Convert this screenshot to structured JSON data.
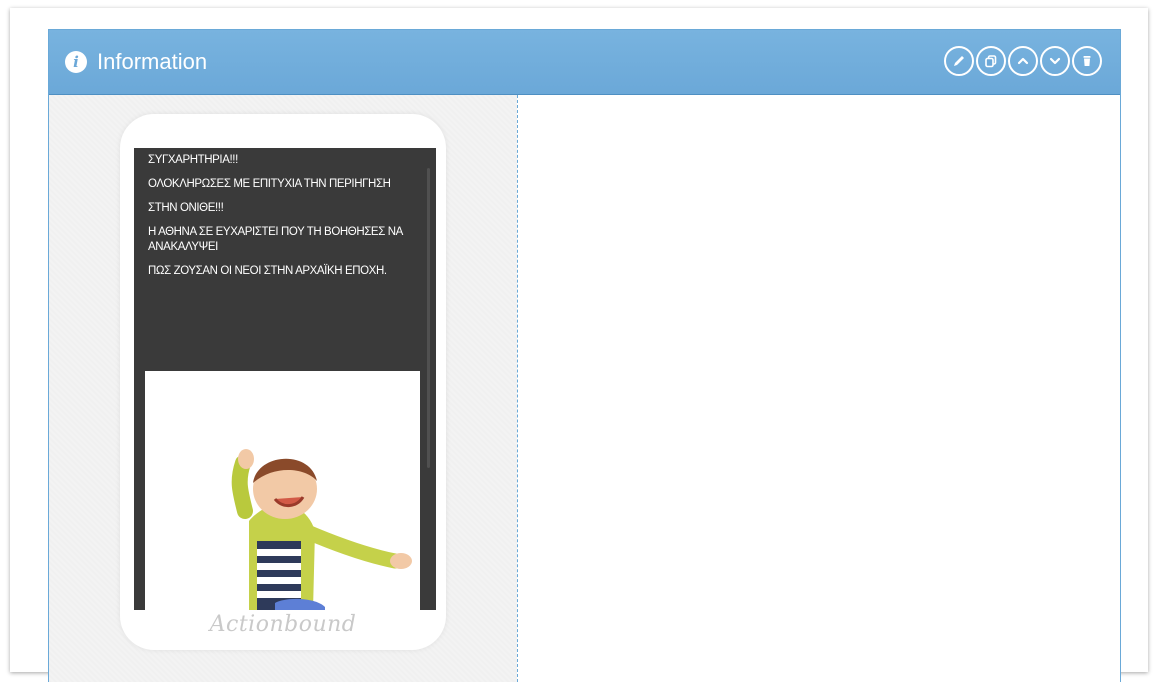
{
  "panel": {
    "title": "Information",
    "info_icon": "info-icon",
    "actions": [
      {
        "name": "edit-button",
        "icon": "pencil-icon"
      },
      {
        "name": "duplicate-button",
        "icon": "copy-icon"
      },
      {
        "name": "move-up-button",
        "icon": "chevron-up-icon"
      },
      {
        "name": "move-down-button",
        "icon": "chevron-down-icon"
      },
      {
        "name": "delete-button",
        "icon": "trash-icon"
      }
    ],
    "header_color": "#6ba8d8"
  },
  "preview": {
    "lines": [
      "ΣΥΓΧΑΡΗΤΗΡΙΑ!!!",
      "ΟΛΟΚΛΗΡΩΣΕΣ ΜΕ ΕΠΙΤΥΧΙΑ ΤΗΝ ΠΕΡΙΗΓΗΣΗ",
      "ΣΤΗΝ ΟΝΙΘΕ!!!",
      "Η ΑΘΗΝΑ ΣΕ ΕΥΧΑΡΙΣΤΕΙ ΠΟΥ ΤΗ ΒΟΗΘΗΣΕΣ ΝΑ ΑΝΑΚΑΛΥΨΕΙ",
      "ΠΩΣ ΖΟΥΣΑΝ ΟΙ ΝΕΟΙ ΣΤΗΝ ΑΡΧΑΪΚΗ ΕΠΟΧΗ."
    ],
    "brand": "Actionbound",
    "image": "jumping-boy-illustration"
  }
}
